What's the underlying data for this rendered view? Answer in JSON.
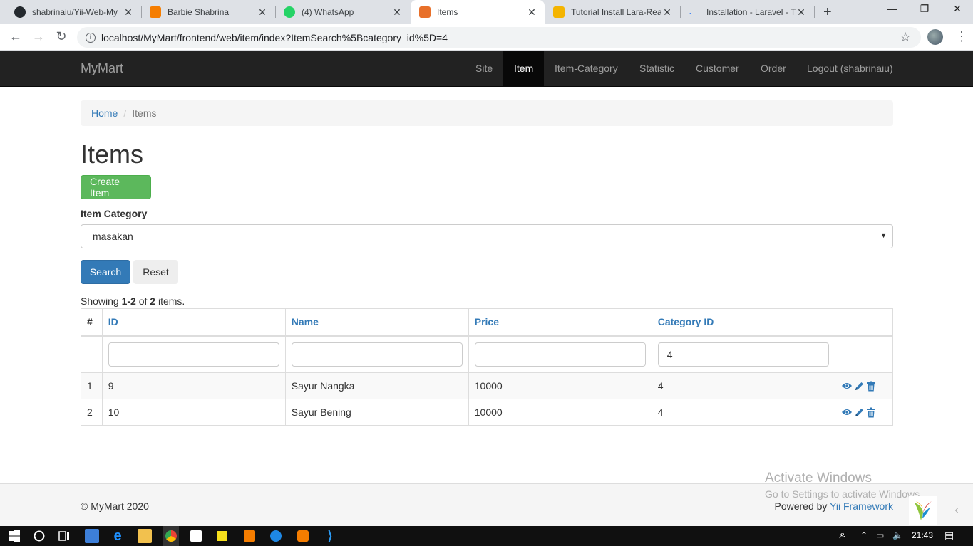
{
  "browser": {
    "tabs": [
      {
        "title": "shabrinaiu/Yii-Web-My",
        "color": "#24292e"
      },
      {
        "title": "Barbie Shabrina",
        "color": "#f57d00"
      },
      {
        "title": "(4) WhatsApp",
        "color": "#25d366"
      },
      {
        "title": "Items",
        "color": "#e8702a"
      },
      {
        "title": "Tutorial Install Lara-Rea",
        "color": "#f4b400"
      },
      {
        "title": "Installation - Laravel - T",
        "color": "#4285f4"
      }
    ],
    "url": "localhost/MyMart/frontend/web/item/index?ItemSearch%5Bcategory_id%5D=4"
  },
  "navbar": {
    "brand": "MyMart",
    "items": [
      "Site",
      "Item",
      "Item-Category",
      "Statistic",
      "Customer",
      "Order",
      "Logout (shabrinaiu)"
    ],
    "active": "Item"
  },
  "breadcrumb": {
    "home": "Home",
    "current": "Items"
  },
  "page": {
    "title": "Items",
    "create_label": "Create Item",
    "category_label": "Item Category",
    "category_selected": "masakan",
    "search_label": "Search",
    "reset_label": "Reset",
    "summary": {
      "prefix": "Showing ",
      "range": "1-2",
      "of": " of ",
      "total": "2",
      "suffix": " items."
    }
  },
  "table": {
    "headers": [
      "#",
      "ID",
      "Name",
      "Price",
      "Category ID"
    ],
    "filters": [
      "",
      "",
      "",
      "4"
    ],
    "rows": [
      {
        "num": "1",
        "id": "9",
        "name": "Sayur Nangka",
        "price": "10000",
        "category_id": "4"
      },
      {
        "num": "2",
        "id": "10",
        "name": "Sayur Bening",
        "price": "10000",
        "category_id": "4"
      }
    ]
  },
  "footer": {
    "copyright": "© MyMart 2020",
    "powered_prefix": "Powered by ",
    "powered_link": "Yii Framework"
  },
  "watermark": {
    "line1": "Activate Windows",
    "line2": "Go to Settings to activate Windows."
  },
  "taskbar": {
    "time": "21:43"
  },
  "colors": {
    "link": "#337ab7",
    "success": "#5cb85c",
    "primary": "#337ab7",
    "navbar": "#222222"
  }
}
